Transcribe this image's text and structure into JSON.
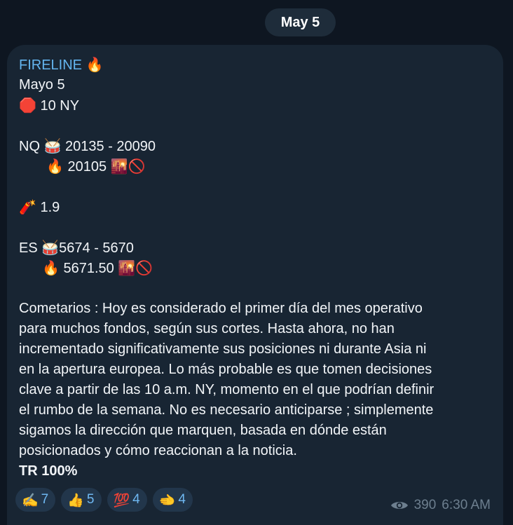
{
  "date_pill": "May 5",
  "message": {
    "channel": "FIRELINE",
    "channel_emoji": "🔥",
    "date_line": "Mayo 5",
    "stop_emoji": "🛑",
    "time_line": "10 NY",
    "nq": {
      "label": "NQ",
      "drum_emoji": "🥁",
      "range": "20135 - 20090",
      "fire_emoji": "🔥",
      "level": "20105",
      "sunset_emoji": "🌇",
      "no_emoji": "🚫"
    },
    "dynamite": {
      "emoji": "🧨",
      "value": "1.9"
    },
    "es": {
      "label": "ES",
      "drum_emoji": "🥁",
      "range": "5674 - 5670",
      "fire_emoji": "🔥",
      "level": "5671.50",
      "sunset_emoji": "🌇",
      "no_emoji": "🚫"
    },
    "comment_lines": [
      "Cometarios : Hoy es considerado el primer día del mes operativo",
      "para muchos fondos, según sus cortes. Hasta ahora, no han",
      "incrementado significativamente sus posiciones ni durante Asia ni",
      "en la apertura europea. Lo más probable es que tomen decisiones",
      "clave a partir de las 10 a.m. NY, momento en el que podrían definir",
      "el rumbo de la semana. No es necesario anticiparse ; simplemente",
      "sigamos la dirección que marquen, basada en dónde están",
      "posicionados y cómo reaccionan a la noticia."
    ],
    "tr": "TR 100%"
  },
  "reactions": [
    {
      "emoji": "✍️",
      "count": "7"
    },
    {
      "emoji": "👍",
      "count": "5"
    },
    {
      "emoji": "💯",
      "count": "4"
    },
    {
      "emoji": "🫲",
      "count": "4"
    }
  ],
  "views": "390",
  "time": "6:30 AM",
  "colors": {
    "background": "#0e1621",
    "bubble": "#182533",
    "channel_name": "#64b5ef",
    "reaction_bg": "#22364b",
    "meta": "#6d7f8f"
  },
  "icons": {
    "views": "eye-icon"
  }
}
